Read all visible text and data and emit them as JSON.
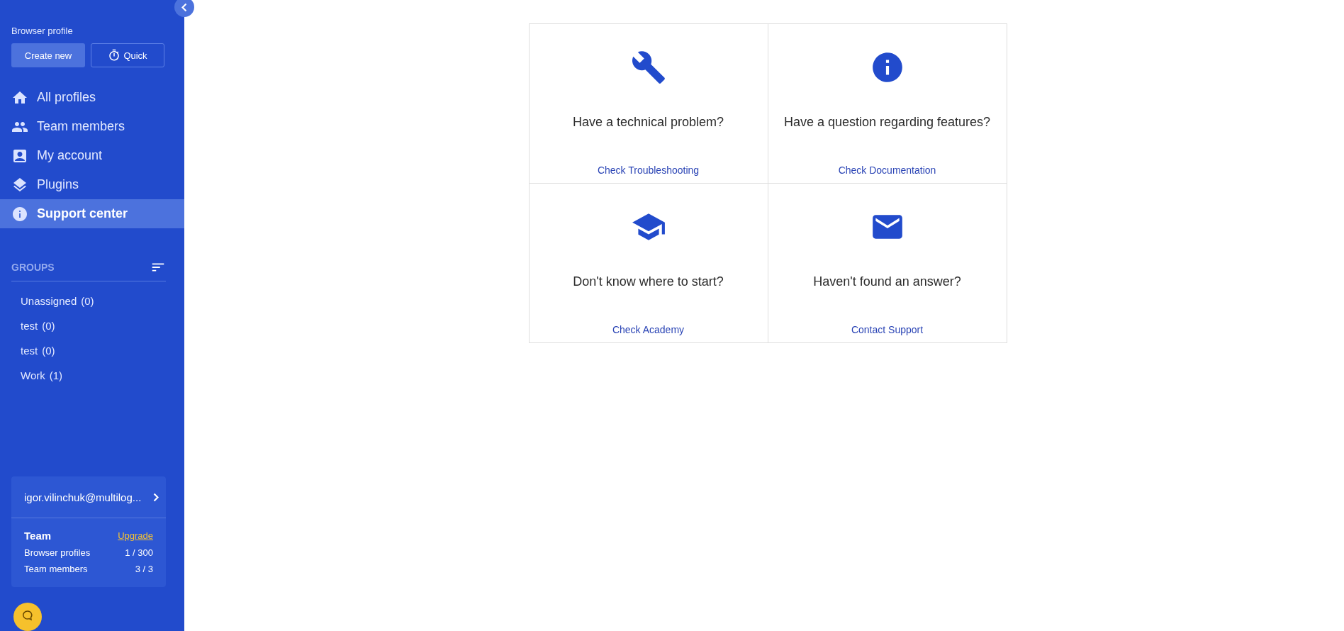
{
  "sidebar": {
    "section_label": "Browser profile",
    "buttons": [
      {
        "label": "Create new",
        "kind": "primary"
      },
      {
        "label": "Quick",
        "kind": "outline"
      }
    ],
    "nav": [
      {
        "label": "All profiles",
        "selected": false
      },
      {
        "label": "Team members",
        "selected": false
      },
      {
        "label": "My account",
        "selected": false
      },
      {
        "label": "Plugins",
        "selected": false
      },
      {
        "label": "Support center",
        "selected": true
      }
    ],
    "groups_title": "GROUPS",
    "groups": [
      {
        "name": "Unassigned",
        "count": "(0)"
      },
      {
        "name": "test",
        "count": "(0)"
      },
      {
        "name": "test",
        "count": "(0)"
      },
      {
        "name": "Work",
        "count": "(1)"
      }
    ],
    "account": {
      "email": "igor.vilinchuk@multilog...",
      "plan": "Team",
      "upgrade": "Upgrade",
      "stats": [
        {
          "label": "Browser profiles",
          "value": "1 / 300"
        },
        {
          "label": "Team members",
          "value": "3 / 3"
        }
      ]
    }
  },
  "cards": [
    {
      "question": "Have a technical problem?",
      "link": "Check Troubleshooting"
    },
    {
      "question": "Have a question regarding features?",
      "link": "Check Documentation"
    },
    {
      "question": "Don't know where to start?",
      "link": "Check Academy"
    },
    {
      "question": "Haven't found an answer?",
      "link": "Contact Support"
    }
  ]
}
